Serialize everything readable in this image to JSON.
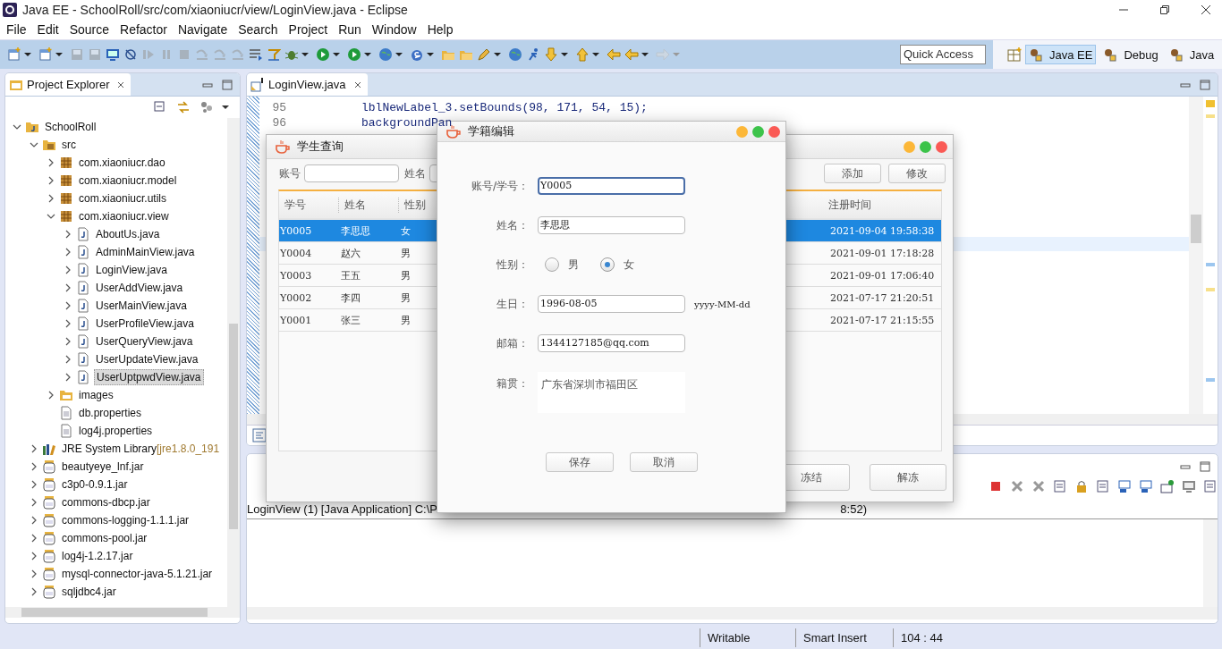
{
  "window": {
    "title": "Java EE - SchoolRoll/src/com/xiaoniucr/view/LoginView.java - Eclipse"
  },
  "menu": [
    "File",
    "Edit",
    "Source",
    "Refactor",
    "Navigate",
    "Search",
    "Project",
    "Run",
    "Window",
    "Help"
  ],
  "quick_access": {
    "placeholder": "Quick Access"
  },
  "perspectives": [
    {
      "label": "Java EE",
      "selected": true
    },
    {
      "label": "Debug",
      "selected": false
    },
    {
      "label": "Java",
      "selected": false
    }
  ],
  "project_explorer": {
    "title": "Project Explorer",
    "tree": [
      {
        "label": "SchoolRoll",
        "kind": "project",
        "expanded": true,
        "selected": false,
        "children": [
          {
            "label": "src",
            "kind": "source",
            "expanded": true,
            "selected": false,
            "children": [
              {
                "label": "com.xiaoniucr.dao",
                "kind": "package",
                "expanded": false,
                "selected": false
              },
              {
                "label": "com.xiaoniucr.model",
                "kind": "package",
                "expanded": false,
                "selected": false
              },
              {
                "label": "com.xiaoniucr.utils",
                "kind": "package",
                "expanded": false,
                "selected": false
              },
              {
                "label": "com.xiaoniucr.view",
                "kind": "package",
                "expanded": true,
                "selected": false,
                "children": [
                  {
                    "label": "AboutUs.java",
                    "kind": "java",
                    "expanded": false,
                    "selected": false
                  },
                  {
                    "label": "AdminMainView.java",
                    "kind": "java",
                    "expanded": false,
                    "selected": false
                  },
                  {
                    "label": "LoginView.java",
                    "kind": "java",
                    "expanded": false,
                    "selected": false
                  },
                  {
                    "label": "UserAddView.java",
                    "kind": "java",
                    "expanded": false,
                    "selected": false
                  },
                  {
                    "label": "UserMainView.java",
                    "kind": "java",
                    "expanded": false,
                    "selected": false
                  },
                  {
                    "label": "UserProfileView.java",
                    "kind": "java",
                    "expanded": false,
                    "selected": false
                  },
                  {
                    "label": "UserQueryView.java",
                    "kind": "java",
                    "expanded": false,
                    "selected": false
                  },
                  {
                    "label": "UserUpdateView.java",
                    "kind": "java",
                    "expanded": false,
                    "selected": false
                  },
                  {
                    "label": "UserUptpwdView.java",
                    "kind": "java",
                    "expanded": false,
                    "selected": true
                  }
                ]
              },
              {
                "label": "images",
                "kind": "folder",
                "expanded": false,
                "selected": false
              },
              {
                "label": "db.properties",
                "kind": "file",
                "selected": false
              },
              {
                "label": "log4j.properties",
                "kind": "file",
                "selected": false
              }
            ]
          },
          {
            "label": "JRE System Library",
            "suffix": "[jre1.8.0_191",
            "kind": "library",
            "expanded": false,
            "selected": false
          },
          {
            "label": "beautyeye_lnf.jar",
            "kind": "jar",
            "expanded": false,
            "selected": false
          },
          {
            "label": "c3p0-0.9.1.jar",
            "kind": "jar",
            "expanded": false,
            "selected": false
          },
          {
            "label": "commons-dbcp.jar",
            "kind": "jar",
            "expanded": false,
            "selected": false
          },
          {
            "label": "commons-logging-1.1.1.jar",
            "kind": "jar",
            "expanded": false,
            "selected": false
          },
          {
            "label": "commons-pool.jar",
            "kind": "jar",
            "expanded": false,
            "selected": false
          },
          {
            "label": "log4j-1.2.17.jar",
            "kind": "jar",
            "expanded": false,
            "selected": false
          },
          {
            "label": "mysql-connector-java-5.1.21.jar",
            "kind": "jar",
            "expanded": false,
            "selected": false
          },
          {
            "label": "sqljdbc4.jar",
            "kind": "jar",
            "expanded": false,
            "selected": false
          }
        ]
      }
    ]
  },
  "editor": {
    "tab": "LoginView.java",
    "lines": [
      {
        "number": "95",
        "code": "lblNewLabel_3.setBounds(98, 171, 54, 15);"
      },
      {
        "number": "96",
        "code": "backgroundPan"
      }
    ]
  },
  "console": {
    "launch": "LoginView (1) [Java Application] C:\\P",
    "launch_tail": "8:52)"
  },
  "query_window": {
    "title": "学生查询",
    "search_labels": [
      "账号",
      "姓名"
    ],
    "buttons": [
      "添加",
      "修改"
    ],
    "columns": [
      "学号",
      "姓名",
      "性别"
    ],
    "time_column": "注册时间",
    "rows": [
      {
        "id": "Y0005",
        "name": "李思思",
        "gender": "女",
        "registered": "2021-09-04 19:58:38",
        "selected": true
      },
      {
        "id": "Y0004",
        "name": "赵六",
        "gender": "男",
        "registered": "2021-09-01 17:18:28",
        "selected": false
      },
      {
        "id": "Y0003",
        "name": "王五",
        "gender": "男",
        "registered": "2021-09-01 17:06:40",
        "selected": false
      },
      {
        "id": "Y0002",
        "name": "李四",
        "gender": "男",
        "registered": "2021-07-17 21:20:51",
        "selected": false
      },
      {
        "id": "Y0001",
        "name": "张三",
        "gender": "男",
        "registered": "2021-07-17 21:15:55",
        "selected": false
      }
    ],
    "bottom_buttons": [
      "冻结",
      "解冻"
    ]
  },
  "edit_dialog": {
    "title": "学籍编辑",
    "fields": [
      {
        "kind": "text",
        "label": "账号/学号：",
        "value": "Y0005",
        "focused": true
      },
      {
        "kind": "text",
        "label": "姓名：",
        "value": "李思思",
        "focused": false
      },
      {
        "kind": "radio",
        "label": "性别：",
        "options": [
          {
            "label": "男",
            "selected": false
          },
          {
            "label": "女",
            "selected": true
          }
        ]
      },
      {
        "kind": "text",
        "label": "生日：",
        "value": "1996-08-05",
        "focused": false,
        "note": "yyyy-MM-dd"
      },
      {
        "kind": "text",
        "label": "邮箱：",
        "value": "1344127185@qq.com",
        "focused": false
      },
      {
        "kind": "area",
        "label": "籍贯：",
        "value": "广东省深圳市福田区"
      }
    ],
    "buttons": [
      "保存",
      "取消"
    ]
  },
  "status_bar": [
    "Writable",
    "Smart Insert",
    "104 : 44"
  ]
}
